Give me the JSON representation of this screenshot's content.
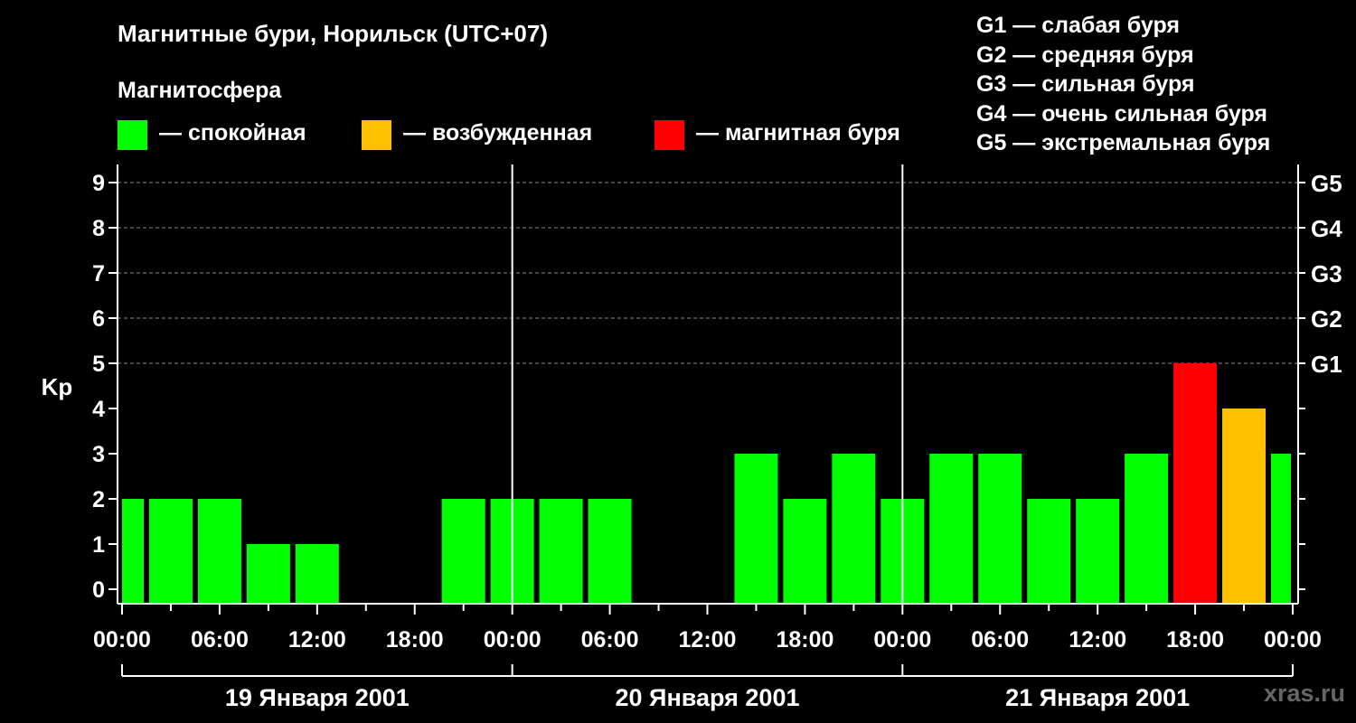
{
  "header": {
    "title": "Магнитные бури, Норильск (UTC+07)",
    "subtitle": "Магнитосфера"
  },
  "legend": {
    "items": [
      {
        "label": "— спокойная",
        "color": "#00ff00"
      },
      {
        "label": "— возбужденная",
        "color": "#ffc000"
      },
      {
        "label": "— магнитная буря",
        "color": "#ff0000"
      }
    ],
    "g_levels": [
      "G1 — слабая буря",
      "G2 — средняя буря",
      "G3 — сильная буря",
      "G4 — очень сильная буря",
      "G5 — экстремальная буря"
    ]
  },
  "brand": "xras.ru",
  "chart_data": {
    "type": "bar",
    "ylabel": "Kp",
    "ylim": [
      0,
      9
    ],
    "y_ticks": [
      "0",
      "1",
      "2",
      "3",
      "4",
      "5",
      "6",
      "7",
      "8",
      "9"
    ],
    "right_axis_labels": [
      {
        "kp": 5,
        "label": "G1"
      },
      {
        "kp": 6,
        "label": "G2"
      },
      {
        "kp": 7,
        "label": "G3"
      },
      {
        "kp": 8,
        "label": "G4"
      },
      {
        "kp": 9,
        "label": "G5"
      }
    ],
    "x_ticks": [
      "00:00",
      "06:00",
      "12:00",
      "18:00",
      "00:00",
      "06:00",
      "12:00",
      "18:00",
      "00:00",
      "06:00",
      "12:00",
      "18:00",
      "00:00"
    ],
    "days": [
      "19 Января 2001",
      "20 Января 2001",
      "21 Января 2001"
    ],
    "interval_hours": 3,
    "values": [
      2,
      2,
      2,
      1,
      1,
      0,
      0,
      2,
      2,
      2,
      2,
      0,
      0,
      3,
      2,
      3,
      2,
      3,
      3,
      2,
      2,
      3,
      5,
      4,
      3
    ],
    "colors": {
      "quiet": "#00ff00",
      "active": "#ffc000",
      "storm": "#ff0000"
    },
    "grid": true
  }
}
